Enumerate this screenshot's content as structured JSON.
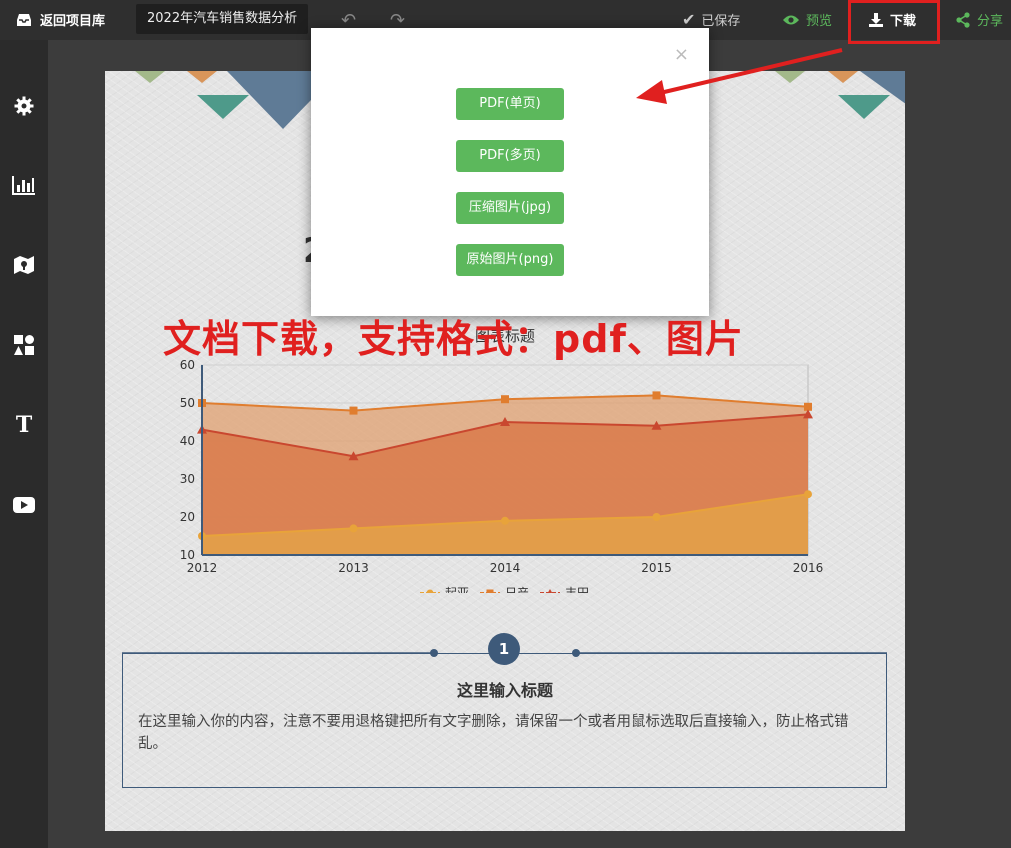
{
  "topbar": {
    "back_label": "返回项目库",
    "doc_title": "2022年汽车销售数据分析",
    "saved_label": "已保存",
    "preview_label": "预览",
    "download_label": "下载",
    "share_label": "分享"
  },
  "sidebar": {
    "items": [
      {
        "icon": "gear-icon"
      },
      {
        "icon": "bar-chart-icon"
      },
      {
        "icon": "map-icon"
      },
      {
        "icon": "shapes-icon"
      },
      {
        "icon": "text-icon"
      },
      {
        "icon": "video-icon"
      }
    ]
  },
  "page": {
    "title_fragment": "2",
    "chart_title": "图表标题",
    "info": {
      "number": "1",
      "title": "这里输入标题",
      "body": "在这里输入你的内容，注意不要用退格键把所有文字删除，请保留一个或者用鼠标选取后直接输入，防止格式错乱。"
    }
  },
  "modal": {
    "close": "×",
    "buttons": [
      "PDF(单页)",
      "PDF(多页)",
      "压缩图片(jpg)",
      "原始图片(png)"
    ]
  },
  "annotation": {
    "text": "文档下载，支持格式：pdf、图片"
  },
  "colors": {
    "accent_green": "#5cb85c",
    "highlight_red": "#e0201f",
    "navy": "#3e5a7a"
  },
  "chart_data": {
    "type": "area",
    "title": "图表标题",
    "x": [
      "2012",
      "2013",
      "2014",
      "2015",
      "2016"
    ],
    "ylim": [
      10,
      60
    ],
    "yticks": [
      10,
      20,
      30,
      40,
      50,
      60
    ],
    "series": [
      {
        "name": "起亚",
        "values": [
          15,
          17,
          19,
          20,
          26
        ],
        "color": "#e8a33a",
        "marker": "circle"
      },
      {
        "name": "日产",
        "values": [
          50,
          48,
          51,
          52,
          49
        ],
        "color": "#e07d2e",
        "marker": "square"
      },
      {
        "name": "丰田",
        "values": [
          43,
          36,
          45,
          44,
          47
        ],
        "color": "#c9472f",
        "marker": "triangle"
      }
    ],
    "legend_position": "bottom"
  }
}
